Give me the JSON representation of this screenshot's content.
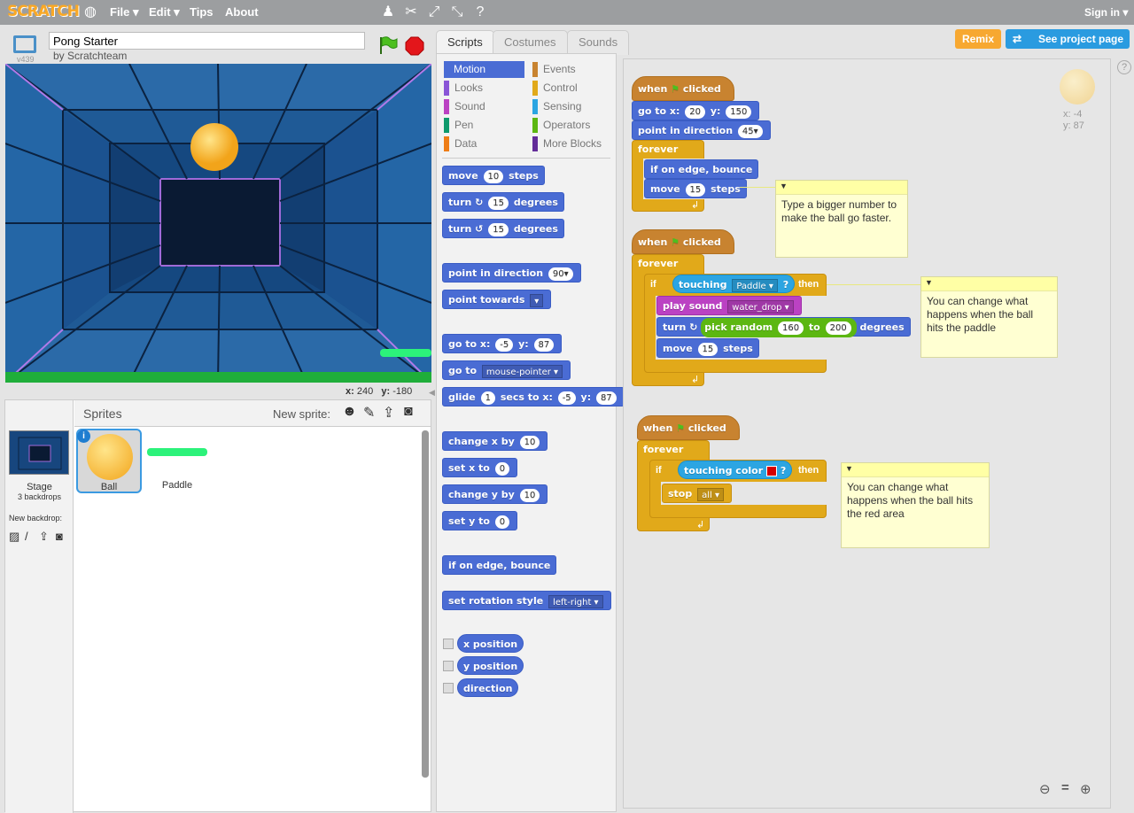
{
  "topbar": {
    "logo": "SCRATCH",
    "menu": [
      "File ▾",
      "Edit ▾",
      "Tips",
      "About"
    ],
    "sign_in": "Sign in ▾"
  },
  "project": {
    "title": "Pong Starter",
    "author": "by Scratchteam",
    "version": "v439"
  },
  "stage_coords": {
    "x_label": "x:",
    "x": "240",
    "y_label": "y:",
    "y": "-180"
  },
  "sprites": {
    "heading": "Sprites",
    "new_sprite": "New sprite:",
    "stage_label": "Stage",
    "stage_backdrops": "3 backdrops",
    "new_backdrop": "New backdrop:",
    "items": [
      {
        "name": "Ball"
      },
      {
        "name": "Paddle"
      }
    ]
  },
  "tabs": [
    "Scripts",
    "Costumes",
    "Sounds"
  ],
  "buttons": {
    "remix": "Remix",
    "see_project": "See project page"
  },
  "categories": [
    {
      "label": "Motion",
      "color": "#4a6cd4"
    },
    {
      "label": "Events",
      "color": "#c88330"
    },
    {
      "label": "Looks",
      "color": "#8a55d7"
    },
    {
      "label": "Control",
      "color": "#e1a91a"
    },
    {
      "label": "Sound",
      "color": "#bb42c3"
    },
    {
      "label": "Sensing",
      "color": "#2ca5e2"
    },
    {
      "label": "Pen",
      "color": "#0e9a6c"
    },
    {
      "label": "Operators",
      "color": "#5cb712"
    },
    {
      "label": "Data",
      "color": "#ee7d16"
    },
    {
      "label": "More Blocks",
      "color": "#632d99"
    }
  ],
  "palette": {
    "move": {
      "a": "move",
      "v": "10",
      "b": "steps"
    },
    "turn_r": {
      "a": "turn ↻",
      "v": "15",
      "b": "degrees"
    },
    "turn_l": {
      "a": "turn ↺",
      "v": "15",
      "b": "degrees"
    },
    "point_dir": {
      "a": "point in direction",
      "v": "90▾"
    },
    "point_towards": {
      "a": "point towards",
      "v": "▾"
    },
    "goto_xy": {
      "a": "go to x:",
      "x": "-5",
      "b": "y:",
      "y": "87"
    },
    "goto": {
      "a": "go to",
      "v": "mouse-pointer ▾"
    },
    "glide": {
      "a": "glide",
      "v": "1",
      "b": "secs to x:",
      "x": "-5",
      "c": "y:",
      "y": "87"
    },
    "change_x": {
      "a": "change x by",
      "v": "10"
    },
    "set_x": {
      "a": "set x to",
      "v": "0"
    },
    "change_y": {
      "a": "change y by",
      "v": "10"
    },
    "set_y": {
      "a": "set y to",
      "v": "0"
    },
    "edge": "if on edge, bounce",
    "rot": {
      "a": "set rotation style",
      "v": "left-right ▾"
    },
    "rep_x": "x position",
    "rep_y": "y position",
    "rep_dir": "direction"
  },
  "sprite_info": {
    "x": "x: -4",
    "y": "y: 87"
  },
  "script1": {
    "hat": {
      "a": "when",
      "b": "clicked"
    },
    "goto": {
      "a": "go to x:",
      "x": "20",
      "b": "y:",
      "y": "150"
    },
    "point": {
      "a": "point in direction",
      "v": "45▾"
    },
    "forever": "forever",
    "edge": "if on edge, bounce",
    "move": {
      "a": "move",
      "v": "15",
      "b": "steps"
    }
  },
  "script2": {
    "hat": {
      "a": "when",
      "b": "clicked"
    },
    "forever": "forever",
    "if": "if",
    "then": "then",
    "touching": {
      "a": "touching",
      "v": "Paddle ▾",
      "q": "?"
    },
    "play": {
      "a": "play sound",
      "v": "water_drop ▾"
    },
    "turn": {
      "a": "turn ↻",
      "b": "pick random",
      "v1": "160",
      "c": "to",
      "v2": "200",
      "d": "degrees"
    },
    "move": {
      "a": "move",
      "v": "15",
      "b": "steps"
    }
  },
  "script3": {
    "hat": {
      "a": "when",
      "b": "clicked"
    },
    "forever": "forever",
    "if": "if",
    "then": "then",
    "touching": {
      "a": "touching color",
      "q": "?"
    },
    "stop": {
      "a": "stop",
      "v": "all ▾"
    }
  },
  "notes": [
    "Type a bigger number to make the ball go faster.",
    "You can change what happens when the ball hits the paddle",
    "You can change what happens when the ball hits the red area"
  ],
  "colors": {
    "touch_color": "#d40000"
  }
}
